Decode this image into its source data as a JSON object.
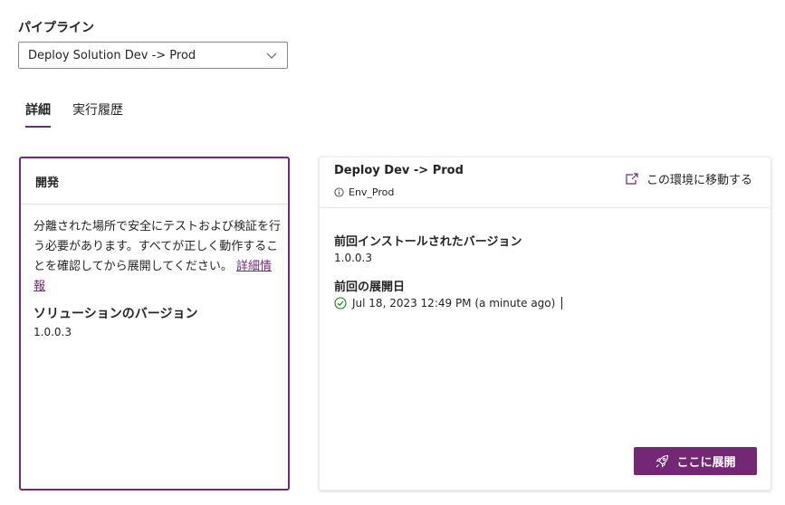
{
  "pipeline": {
    "label": "パイプライン",
    "selected": "Deploy Solution Dev -> Prod"
  },
  "tabs": [
    {
      "label": "詳細",
      "active": true
    },
    {
      "label": "実行履歴",
      "active": false
    }
  ],
  "dev_card": {
    "title": "開発",
    "description": "分離された場所で安全にテストおよび検証を行う必要があります。すべてが正しく動作することを確認してから展開してください。",
    "learn_more": "詳細情報",
    "version_label": "ソリューションのバージョン",
    "version_value": "1.0.0.3"
  },
  "stage_card": {
    "title": "Deploy Dev -> Prod",
    "environment": "Env_Prod",
    "go_to_env": "この環境に移動する",
    "installed_label": "前回インストールされたバージョン",
    "installed_value": "1.0.0.3",
    "last_deploy_label": "前回の展開日",
    "last_deploy_value": "Jul 18, 2023 12:49 PM (a minute ago)",
    "deploy_button": "ここに展開"
  },
  "colors": {
    "accent": "#742774",
    "success": "#107c10"
  },
  "icons": {
    "dropdown": "chevron-down-icon",
    "info": "info-icon",
    "open": "open-external-icon",
    "success": "checkmark-circle-icon",
    "deploy": "rocket-icon"
  }
}
